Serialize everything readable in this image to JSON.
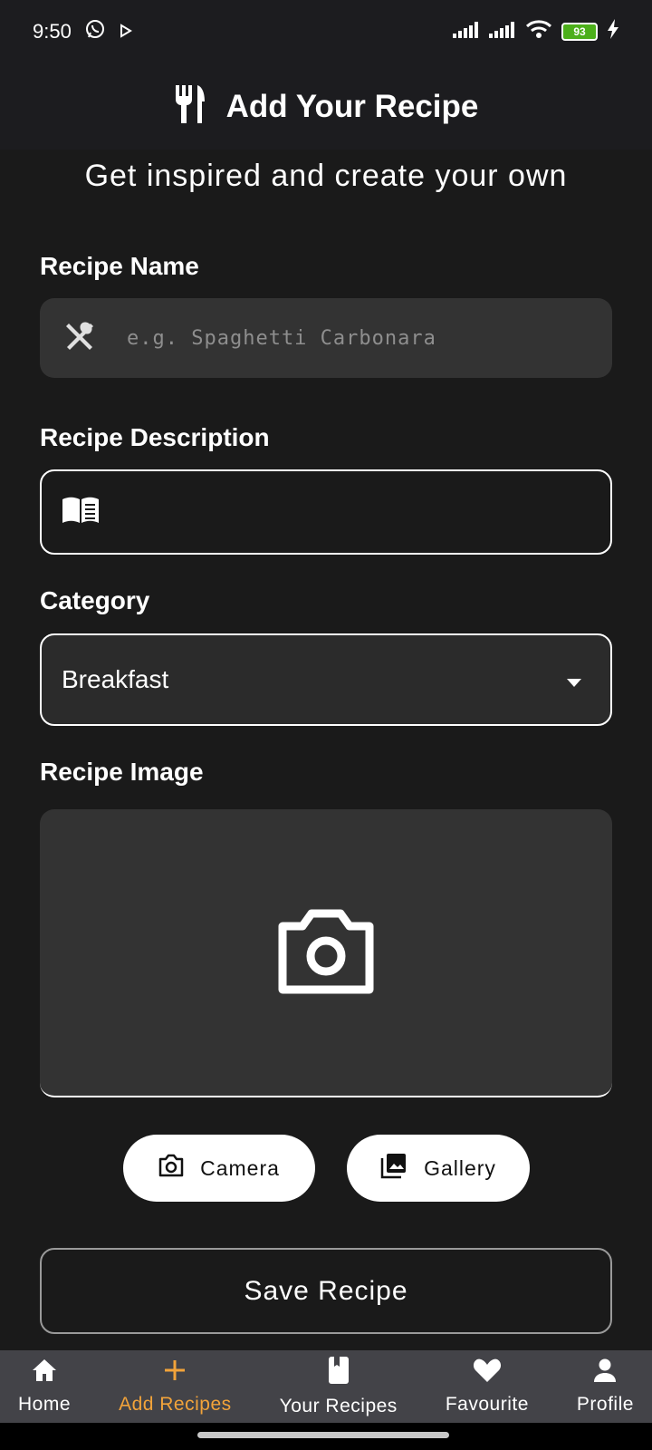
{
  "status": {
    "time": "9:50",
    "battery": "93"
  },
  "appbar": {
    "title": "Add Your Recipe"
  },
  "subtitle": "Get inspired and create your own",
  "form": {
    "name_label": "Recipe Name",
    "name_placeholder": "e.g. Spaghetti Carbonara",
    "name_value": "",
    "description_label": "Recipe Description",
    "description_value": "",
    "category_label": "Category",
    "category_value": "Breakfast",
    "image_label": "Recipe Image",
    "camera_label": "Camera",
    "gallery_label": "Gallery",
    "save_label": "Save Recipe"
  },
  "nav": {
    "items": [
      {
        "label": "Home",
        "icon": "home-icon",
        "active": false
      },
      {
        "label": "Add Recipes",
        "icon": "plus-icon",
        "active": true
      },
      {
        "label": "Your Recipes",
        "icon": "book-icon",
        "active": false
      },
      {
        "label": "Favourite",
        "icon": "heart-icon",
        "active": false
      },
      {
        "label": "Profile",
        "icon": "person-icon",
        "active": false
      }
    ]
  },
  "colors": {
    "background": "#1a1a1a",
    "field": "#333333",
    "accent": "#f2a33a",
    "nav_bg": "#434348",
    "battery": "#4caf1a"
  }
}
